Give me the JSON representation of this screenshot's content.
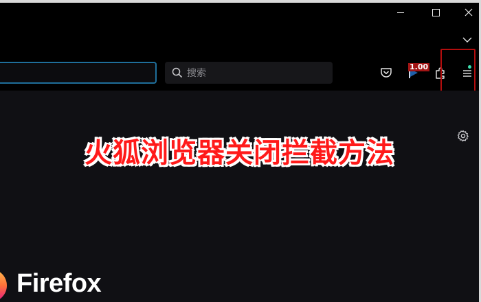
{
  "window": {
    "minimize_label": "minimize",
    "maximize_label": "maximize",
    "close_label": "close"
  },
  "toolbar": {
    "search_placeholder": "搜索",
    "extension_badge": "1.00"
  },
  "icons": {
    "search": "search-icon",
    "pocket": "pocket-icon",
    "extension": "extension-icon",
    "puzzle": "extensions-icon",
    "menu": "hamburger-menu-icon",
    "gear": "gear-icon",
    "list_tabs": "chevron-down-icon",
    "logo": "firefox-logo-icon"
  },
  "overlay": {
    "title": "火狐浏览器关闭拦截方法"
  },
  "newtab": {
    "wordmark": "Firefox"
  },
  "colors": {
    "background": "#0f0f12",
    "urlbar_focus": "#1f6f9b",
    "highlight": "#b30d0d",
    "overlay_text": "#ff1a1a",
    "menu_dot": "#3fe1b0"
  }
}
